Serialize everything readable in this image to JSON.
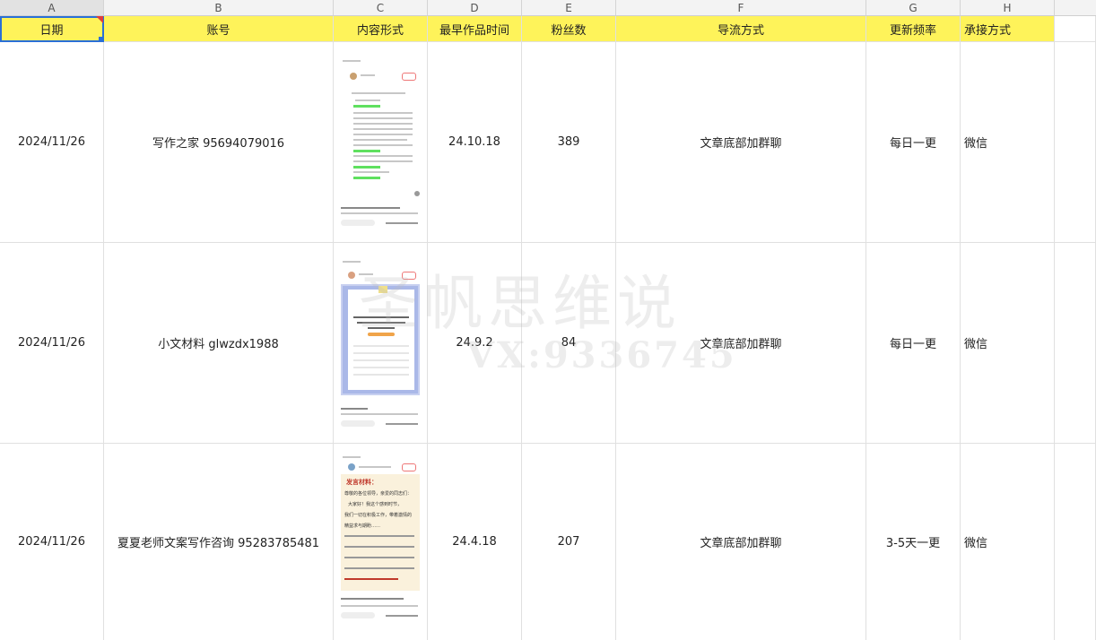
{
  "columns": [
    "A",
    "B",
    "C",
    "D",
    "E",
    "F",
    "G",
    "H"
  ],
  "header": {
    "date": "日期",
    "account": "账号",
    "content_form": "内容形式",
    "earliest": "最早作品时间",
    "fans": "粉丝数",
    "diversion": "导流方式",
    "frequency": "更新频率",
    "contact": "承接方式"
  },
  "rows": [
    {
      "date": "2024/11/26",
      "account": "写作之家 95694079016",
      "earliest": "24.10.18",
      "fans": "389",
      "diversion": "文章底部加群聊",
      "frequency": "每日一更",
      "contact": "微信"
    },
    {
      "date": "2024/11/26",
      "account": "小文材料 glwzdx1988",
      "earliest": "24.9.2",
      "fans": "84",
      "diversion": "文章底部加群聊",
      "frequency": "每日一更",
      "contact": "微信"
    },
    {
      "date": "2024/11/26",
      "account": "夏夏老师文案写作咨询 95283785481",
      "earliest": "24.4.18",
      "fans": "207",
      "diversion": "文章底部加群聊",
      "frequency": "3-5天一更",
      "contact": "微信"
    }
  ],
  "thumbs": {
    "t3_title": "发言材料：",
    "t3_body": [
      "尊敬的各位领导，亲爱的同志们：",
      "大家好！我这个感到时节，",
      "我们一切在积极工作，带着激情的",
      "精益求与期盼……"
    ]
  },
  "watermark": {
    "line1": "圣帆思维说",
    "line2": "VX:9336745"
  },
  "colors": {
    "header_bg": "#fef35a",
    "grid": "#e0e0e0",
    "select": "#2a6fd6"
  }
}
